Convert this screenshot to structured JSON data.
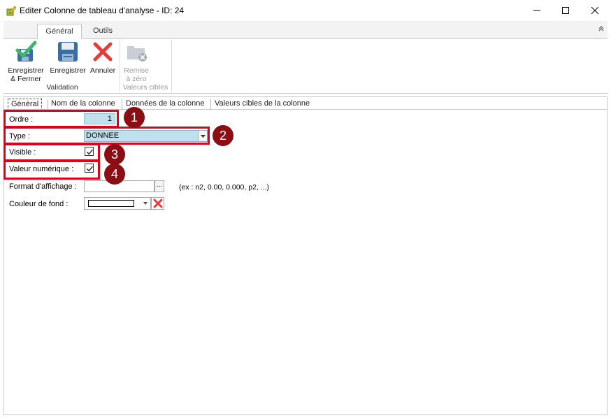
{
  "window": {
    "title": "Editer Colonne de tableau d'analyse - ID: 24",
    "icon": "edit-pencil-icon"
  },
  "ribbon": {
    "tabs": [
      {
        "label": "Général",
        "active": true
      },
      {
        "label": "Outils",
        "active": false
      }
    ],
    "groups": [
      {
        "label": "Validation",
        "buttons": [
          {
            "label_line1": "Enregistrer",
            "label_line2": "& Fermer",
            "icon": "save-close-icon",
            "enabled": true
          },
          {
            "label_line1": "Enregistrer",
            "icon": "floppy-disk-icon",
            "enabled": true
          },
          {
            "label_line1": "Annuler",
            "icon": "cancel-x-icon",
            "enabled": true
          }
        ]
      },
      {
        "label": "Valeurs cibles",
        "buttons": [
          {
            "label_line1": "Remise",
            "label_line2": "à zéro",
            "icon": "folder-reset-icon",
            "enabled": false
          }
        ]
      }
    ]
  },
  "page_tabs": [
    {
      "label": "Général",
      "active": true
    },
    {
      "label": "Nom de la colonne",
      "active": false
    },
    {
      "label": "Données de la colonne",
      "active": false
    },
    {
      "label": "Valeurs cibles de la colonne",
      "active": false
    }
  ],
  "form": {
    "ordre": {
      "label": "Ordre :",
      "value": "1"
    },
    "type": {
      "label": "Type :",
      "value": "DONNEE"
    },
    "visible": {
      "label": "Visible :",
      "checked": true
    },
    "valeur_numerique": {
      "label": "Valeur numérique :",
      "checked": true
    },
    "format": {
      "label": "Format d'affichage :",
      "value": "",
      "button_label": "...",
      "hint": "(ex : n2, 0.00, 0.000, p2, ...)"
    },
    "couleur": {
      "label": "Couleur de fond :",
      "swatch_color": "#ffffff"
    }
  },
  "annotations": {
    "markers": [
      "1",
      "2",
      "3",
      "4"
    ],
    "highlight_color": "#e0001b",
    "marker_color": "#8b0e14"
  }
}
